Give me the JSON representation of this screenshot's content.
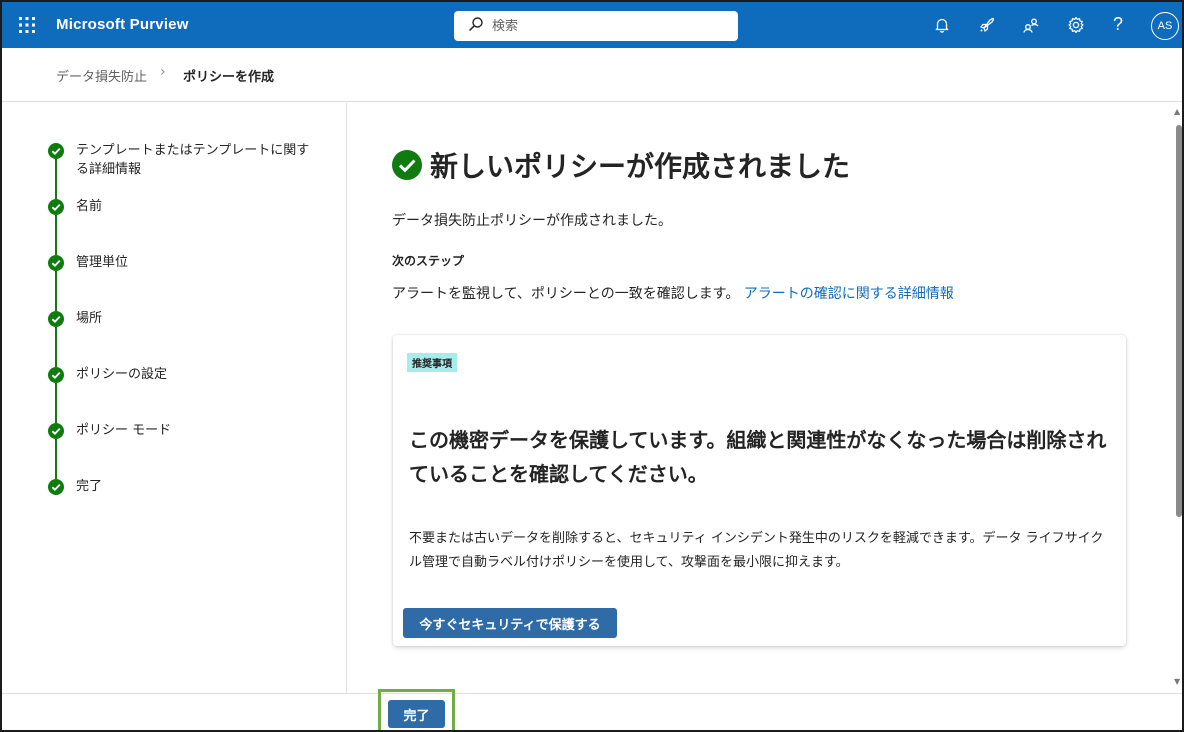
{
  "app": {
    "title": "Microsoft Purview"
  },
  "search": {
    "placeholder": "検索"
  },
  "header_icons": [
    "waffle-icon",
    "bell-icon",
    "rocket-icon",
    "community-icon",
    "gear-icon",
    "help-icon"
  ],
  "help": {
    "label": "?"
  },
  "user": {
    "initials": "AS"
  },
  "breadcrumb": {
    "parent": "データ損失防止",
    "separator": "›",
    "current": "ポリシーを作成"
  },
  "steps": [
    {
      "label": "テンプレートまたはテンプレートに関する詳細情報",
      "status": "complete"
    },
    {
      "label": "名前",
      "status": "complete"
    },
    {
      "label": "管理単位",
      "status": "complete"
    },
    {
      "label": "場所",
      "status": "complete"
    },
    {
      "label": "ポリシーの設定",
      "status": "complete"
    },
    {
      "label": "ポリシー モード",
      "status": "complete"
    },
    {
      "label": "完了",
      "status": "complete"
    }
  ],
  "main": {
    "title": "新しいポリシーが作成されました",
    "description": "データ損失防止ポリシーが作成されました。",
    "next_steps_heading": "次のステップ",
    "next_steps_text": "アラートを監視して、ポリシーとの一致を確認します。",
    "next_steps_link": "アラートの確認に関する詳細情報"
  },
  "recommendation": {
    "badge": "推奨事項",
    "title": "この機密データを保護しています。組織と関連性がなくなった場合は削除されていることを確認してください。",
    "body": "不要または古いデータを削除すると、セキュリティ インシデント発生中のリスクを軽減できます。データ ライフサイクル管理で自動ラベル付けポリシーを使用して、攻撃面を最小限に抑えます。",
    "button_label": "今すぐセキュリティで保護する"
  },
  "footer": {
    "done_label": "完了"
  },
  "colors": {
    "header": "#0f6cbd",
    "step_complete": "#107c10",
    "primary_button": "#2f6ba7",
    "badge": "#a8ebeb",
    "highlight": "#70ad47"
  }
}
